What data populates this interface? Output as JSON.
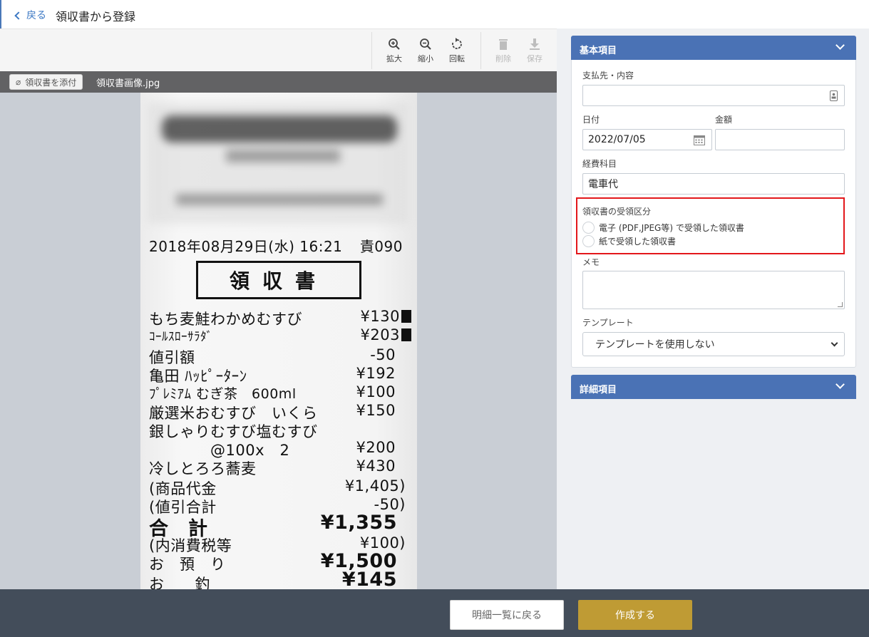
{
  "header": {
    "back_label": "戻る",
    "title": "領収書から登録"
  },
  "toolbar": {
    "zoom_in_label": "拡大",
    "zoom_out_label": "縮小",
    "rotate_label": "回転",
    "delete_label": "削除",
    "save_label": "保存"
  },
  "file_bar": {
    "attach_label": "領収書を添付",
    "file_name": "領収書画像.jpg"
  },
  "receipt": {
    "date_line": "2018年08月29日(水) 16:21",
    "stamp": "責090",
    "heading": "領収書",
    "items": [
      {
        "name": "もち麦鮭わかめむすび",
        "price": "¥130"
      },
      {
        "name": "ｺｰﾙｽﾛｰｻﾗﾀﾞ",
        "price": "¥203"
      },
      {
        "name": "値引額",
        "price": "-50"
      },
      {
        "name": "亀田 ﾊｯﾋﾟｰﾀｰﾝ",
        "price": "¥192"
      },
      {
        "name": "ﾌﾟﾚﾐｱﾑ むぎ茶　600ml",
        "price": "¥100"
      },
      {
        "name": "厳選米おむすび　いくら",
        "price": "¥150"
      },
      {
        "name": "銀しゃりむすび塩むすび",
        "price": ""
      },
      {
        "name": "　　　　@100x　2",
        "price": "¥200"
      },
      {
        "name": "冷しとろろ蕎麦",
        "price": "¥430"
      }
    ],
    "subtotal_label": "(商品代金",
    "subtotal_value": "¥1,405)",
    "discount_label": "(値引合計",
    "discount_value": "-50)",
    "total_label": "合　計",
    "total_value": "¥1,355",
    "tax_label": "(内消費税等",
    "tax_value": "¥100)",
    "paid_label": "お　預　り",
    "paid_value": "¥1,500",
    "change_label": "お　　釣",
    "change_value": "¥145"
  },
  "basic_section": {
    "title": "基本項目",
    "payee_label": "支払先・内容",
    "payee_value": "",
    "date_label": "日付",
    "date_value": "2022/07/05",
    "amount_label": "金額",
    "amount_value": "",
    "category_label": "経費科目",
    "category_value": "電車代",
    "receipt_type_label": "領収書の受領区分",
    "receipt_type_options": [
      "電子 (PDF,JPEG等) で受領した領収書",
      "紙で受領した領収書"
    ],
    "memo_label": "メモ",
    "memo_value": "",
    "template_label": "テンプレート",
    "template_value": "テンプレートを使用しない"
  },
  "detail_section": {
    "title": "詳細項目"
  },
  "footer": {
    "back_list_label": "明細一覧に戻る",
    "create_label": "作成する"
  },
  "colors": {
    "accent": "#4a72b5",
    "create_button": "#bf9b34",
    "highlight": "#e3171b",
    "footer": "#434d5a"
  }
}
